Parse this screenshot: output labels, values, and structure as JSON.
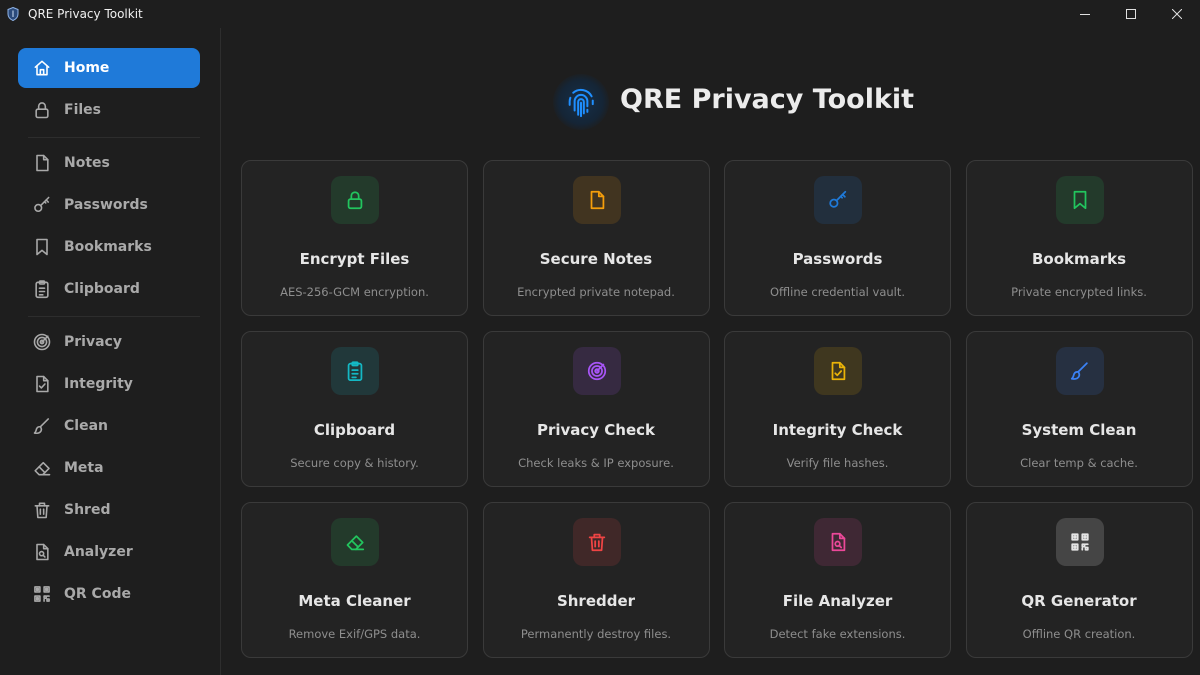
{
  "window": {
    "title": "QRE Privacy Toolkit",
    "controls": {
      "minimize": "minimize-icon",
      "maximize": "maximize-icon",
      "close": "close-icon"
    }
  },
  "sidebar": {
    "items": [
      {
        "label": "Home",
        "icon": "home-icon",
        "active": true
      },
      {
        "label": "Files",
        "icon": "lock-icon"
      },
      {
        "label": "Notes",
        "icon": "note-icon"
      },
      {
        "label": "Passwords",
        "icon": "key-icon"
      },
      {
        "label": "Bookmarks",
        "icon": "bookmark-icon"
      },
      {
        "label": "Clipboard",
        "icon": "clipboard-icon"
      },
      {
        "label": "Privacy",
        "icon": "radar-icon"
      },
      {
        "label": "Integrity",
        "icon": "file-check-icon"
      },
      {
        "label": "Clean",
        "icon": "brush-icon"
      },
      {
        "label": "Meta",
        "icon": "eraser-icon"
      },
      {
        "label": "Shred",
        "icon": "trash-icon"
      },
      {
        "label": "Analyzer",
        "icon": "file-search-icon"
      },
      {
        "label": "QR Code",
        "icon": "qr-code-icon"
      }
    ]
  },
  "header": {
    "title": "QRE Privacy Toolkit",
    "logo": "fingerprint-icon"
  },
  "cards": [
    {
      "title": "Encrypt Files",
      "desc": "AES-256-GCM encryption.",
      "icon": "lock-icon",
      "color": "#22c55e"
    },
    {
      "title": "Secure Notes",
      "desc": "Encrypted private notepad.",
      "icon": "note-icon",
      "color": "#f59e0b"
    },
    {
      "title": "Passwords",
      "desc": "Offline credential vault.",
      "icon": "key-icon",
      "color": "#1f7ad9"
    },
    {
      "title": "Bookmarks",
      "desc": "Private encrypted links.",
      "icon": "bookmark-icon",
      "color": "#22c55e"
    },
    {
      "title": "Clipboard",
      "desc": "Secure copy & history.",
      "icon": "clipboard-icon",
      "color": "#14b8c4"
    },
    {
      "title": "Privacy Check",
      "desc": "Check leaks & IP exposure.",
      "icon": "radar-icon",
      "color": "#a855f7"
    },
    {
      "title": "Integrity Check",
      "desc": "Verify file hashes.",
      "icon": "file-check-icon",
      "color": "#eab308"
    },
    {
      "title": "System Clean",
      "desc": "Clear temp & cache.",
      "icon": "brush-icon",
      "color": "#3b82f6"
    },
    {
      "title": "Meta Cleaner",
      "desc": "Remove Exif/GPS data.",
      "icon": "eraser-icon",
      "color": "#22c55e"
    },
    {
      "title": "Shredder",
      "desc": "Permanently destroy files.",
      "icon": "trash-icon",
      "color": "#ef4444"
    },
    {
      "title": "File Analyzer",
      "desc": "Detect fake extensions.",
      "icon": "file-search-icon",
      "color": "#ec4899"
    },
    {
      "title": "QR Generator",
      "desc": "Offline QR creation.",
      "icon": "qr-code-icon",
      "color": "#e5e5e5"
    }
  ]
}
